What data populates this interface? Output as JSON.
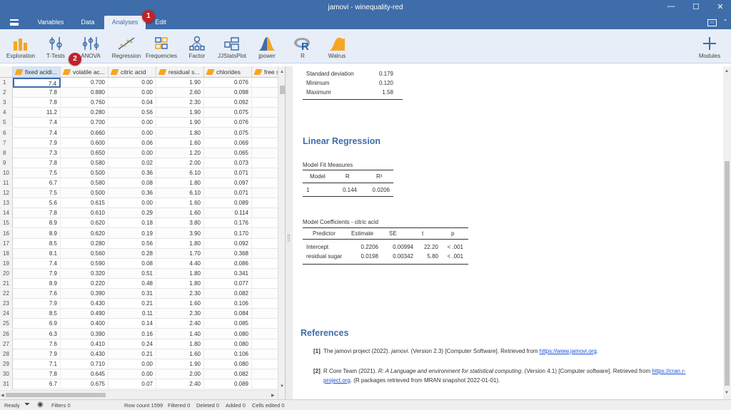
{
  "window": {
    "title": "jamovi - winequality-red",
    "min": "—",
    "max": "☐",
    "close": "✕"
  },
  "menu": {
    "tabs": [
      "Variables",
      "Data",
      "Analyses",
      "Edit"
    ]
  },
  "badges": [
    "1",
    "2"
  ],
  "ribbon": {
    "tools": [
      {
        "label": "Exploration",
        "icon": "exploration-icon"
      },
      {
        "label": "T-Tests",
        "icon": "ttests-icon"
      },
      {
        "label": "ANOVA",
        "icon": "anova-icon"
      },
      {
        "label": "Regression",
        "icon": "regression-icon"
      },
      {
        "label": "Frequencies",
        "icon": "frequencies-icon"
      },
      {
        "label": "Factor",
        "icon": "factor-icon"
      },
      {
        "label": "JJStatsPlot",
        "icon": "jjstatsplot-icon"
      },
      {
        "label": "jpower",
        "icon": "jpower-icon"
      },
      {
        "label": "R",
        "icon": "r-icon"
      },
      {
        "label": "Walrus",
        "icon": "walrus-icon"
      }
    ],
    "modules": "Modules"
  },
  "grid": {
    "columns": [
      "fixed acidi...",
      "volatile ac...",
      "citric acid",
      "residual s...",
      "chlorides",
      "free sulf"
    ],
    "rows": [
      [
        "1",
        "7.4",
        "0.700",
        "0.00",
        "1.90",
        "0.076"
      ],
      [
        "2",
        "7.8",
        "0.880",
        "0.00",
        "2.60",
        "0.098"
      ],
      [
        "3",
        "7.8",
        "0.760",
        "0.04",
        "2.30",
        "0.092"
      ],
      [
        "4",
        "11.2",
        "0.280",
        "0.56",
        "1.90",
        "0.075"
      ],
      [
        "5",
        "7.4",
        "0.700",
        "0.00",
        "1.90",
        "0.076"
      ],
      [
        "6",
        "7.4",
        "0.660",
        "0.00",
        "1.80",
        "0.075"
      ],
      [
        "7",
        "7.9",
        "0.600",
        "0.06",
        "1.60",
        "0.069"
      ],
      [
        "8",
        "7.3",
        "0.650",
        "0.00",
        "1.20",
        "0.065"
      ],
      [
        "9",
        "7.8",
        "0.580",
        "0.02",
        "2.00",
        "0.073"
      ],
      [
        "10",
        "7.5",
        "0.500",
        "0.36",
        "6.10",
        "0.071"
      ],
      [
        "11",
        "6.7",
        "0.580",
        "0.08",
        "1.80",
        "0.097"
      ],
      [
        "12",
        "7.5",
        "0.500",
        "0.36",
        "6.10",
        "0.071"
      ],
      [
        "13",
        "5.6",
        "0.615",
        "0.00",
        "1.60",
        "0.089"
      ],
      [
        "14",
        "7.8",
        "0.610",
        "0.29",
        "1.60",
        "0.114"
      ],
      [
        "15",
        "8.9",
        "0.620",
        "0.18",
        "3.80",
        "0.176"
      ],
      [
        "16",
        "8.9",
        "0.620",
        "0.19",
        "3.90",
        "0.170"
      ],
      [
        "17",
        "8.5",
        "0.280",
        "0.56",
        "1.80",
        "0.092"
      ],
      [
        "18",
        "8.1",
        "0.560",
        "0.28",
        "1.70",
        "0.368"
      ],
      [
        "19",
        "7.4",
        "0.590",
        "0.08",
        "4.40",
        "0.086"
      ],
      [
        "20",
        "7.9",
        "0.320",
        "0.51",
        "1.80",
        "0.341"
      ],
      [
        "21",
        "8.9",
        "0.220",
        "0.48",
        "1.80",
        "0.077"
      ],
      [
        "22",
        "7.6",
        "0.390",
        "0.31",
        "2.30",
        "0.082"
      ],
      [
        "23",
        "7.9",
        "0.430",
        "0.21",
        "1.60",
        "0.106"
      ],
      [
        "24",
        "8.5",
        "0.490",
        "0.11",
        "2.30",
        "0.084"
      ],
      [
        "25",
        "6.9",
        "0.400",
        "0.14",
        "2.40",
        "0.085"
      ],
      [
        "26",
        "6.3",
        "0.390",
        "0.16",
        "1.40",
        "0.080"
      ],
      [
        "27",
        "7.6",
        "0.410",
        "0.24",
        "1.80",
        "0.080"
      ],
      [
        "28",
        "7.9",
        "0.430",
        "0.21",
        "1.60",
        "0.106"
      ],
      [
        "29",
        "7.1",
        "0.710",
        "0.00",
        "1.90",
        "0.080"
      ],
      [
        "30",
        "7.8",
        "0.645",
        "0.00",
        "2.00",
        "0.082"
      ],
      [
        "31",
        "6.7",
        "0.675",
        "0.07",
        "2.40",
        "0.089"
      ]
    ]
  },
  "results": {
    "desc": {
      "rows": [
        [
          "Standard deviation",
          "0.179"
        ],
        [
          "Minimum",
          "0.120"
        ],
        [
          "Maximum",
          "1.58"
        ]
      ]
    },
    "heading": "Linear Regression",
    "fit": {
      "title": "Model Fit Measures",
      "headers": [
        "Model",
        "R",
        "R²"
      ],
      "row": [
        "1",
        "0.144",
        "0.0206"
      ]
    },
    "coef": {
      "title": "Model Coefficients - citric acid",
      "headers": [
        "Predictor",
        "Estimate",
        "SE",
        "t",
        "p"
      ],
      "rows": [
        [
          "Intercept",
          "0.2206",
          "0.00994",
          "22.20",
          "< .001"
        ],
        [
          "residual sugar",
          "0.0198",
          "0.00342",
          "5.80",
          "< .001"
        ]
      ]
    },
    "references": {
      "heading": "References",
      "r1": {
        "num": "[1]",
        "pre": "The jamovi project (2022). ",
        "ital": "jamovi",
        "mid": ". (Version 2.3) [Computer Software]. Retrieved from ",
        "link": "https://www.jamovi.org",
        "post": "."
      },
      "r2": {
        "num": "[2]",
        "pre": "R Core Team (2021). ",
        "ital": "R: A Language and environment for statistical computing",
        "mid": ". (Version 4.1) [Computer software]. Retrieved from ",
        "link1": "https://cran.r-",
        "link2": "project.org",
        "post": ". (R packages retrieved from MRAN snapshot 2022-01-01)."
      }
    }
  },
  "status": {
    "ready": "Ready",
    "filters": "Filters 0",
    "rowcount": "Row count 1599",
    "filtered": "Filtered 0",
    "deleted": "Deleted 0",
    "added": "Added 0",
    "cells": "Cells edited 0"
  },
  "colors": {
    "accent": "#3e6da9",
    "badge": "#c0222a",
    "ribbon": "#e7eef7"
  }
}
